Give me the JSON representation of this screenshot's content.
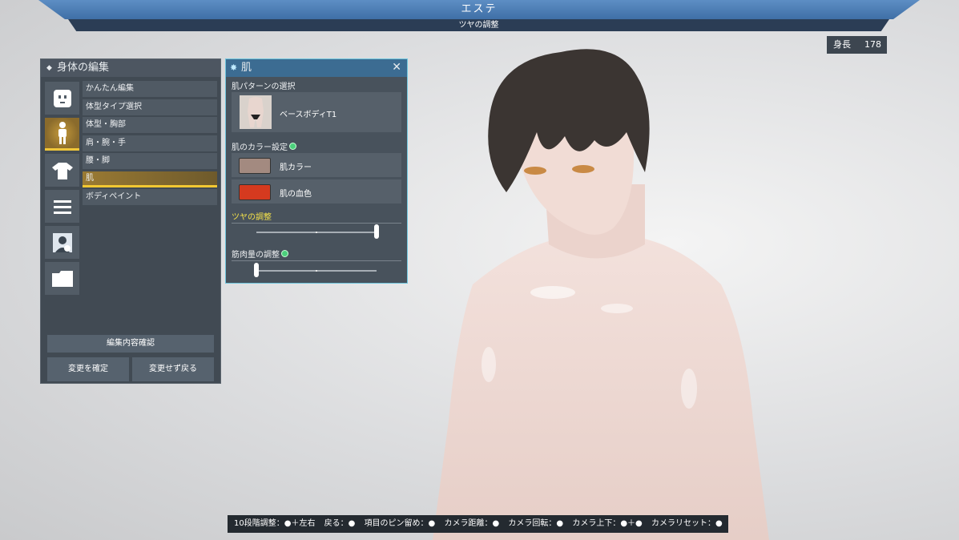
{
  "header": {
    "title": "エステ",
    "subtitle": "ツヤの調整"
  },
  "height_display": {
    "label": "身長",
    "value": "178"
  },
  "body_edit": {
    "title": "身体の編集",
    "menu": [
      {
        "label": "かんたん編集"
      },
      {
        "label": "体型タイプ選択"
      },
      {
        "label": "体型・胸部"
      },
      {
        "label": "肩・腕・手"
      },
      {
        "label": "腰・脚"
      },
      {
        "label": "肌"
      },
      {
        "label": "ボディペイント"
      }
    ],
    "active_index": 5,
    "confirm_label": "編集内容確認",
    "apply_label": "変更を確定",
    "revert_label": "変更せず戻る",
    "icons": [
      "face-icon",
      "body-icon",
      "shirt-icon",
      "list-icon",
      "portrait-icon",
      "folder-icon"
    ]
  },
  "skin_panel": {
    "title": "肌",
    "pattern_label": "肌パターンの選択",
    "pattern_value": "ベースボディT1",
    "color_label": "肌のカラー設定",
    "skin_color_label": "肌カラー",
    "skin_color": "#a38a80",
    "blood_color_label": "肌の血色",
    "blood_color": "#d53a1f",
    "gloss_label": "ツヤの調整",
    "gloss_value": 1.0,
    "muscle_label": "筋肉量の調整",
    "muscle_value": 0.0
  },
  "help_bar": {
    "items": [
      "10段階調整：●＋左右",
      "戻る：●",
      "項目のピン留め：●",
      "カメラ距離：●",
      "カメラ回転：●",
      "カメラ上下：●＋●",
      "カメラリセット：●"
    ]
  },
  "colors": {
    "accent": "#f2c832",
    "panel_border": "#6fc5dd",
    "header": "#4a7db5"
  }
}
